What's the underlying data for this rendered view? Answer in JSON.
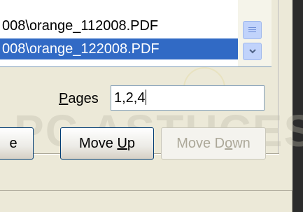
{
  "file_list": {
    "items": [
      {
        "label": "008\\orange_112008.PDF",
        "selected": false
      },
      {
        "label": "008\\orange_122008.PDF",
        "selected": true
      }
    ]
  },
  "pages": {
    "label_underlined": "P",
    "label_rest": "ages",
    "value": "1,2,4"
  },
  "buttons": {
    "partial_label": "e",
    "move_up": {
      "before": "Move ",
      "underlined": "U",
      "after": "p"
    },
    "move_down": {
      "before": "Move D",
      "underlined": "o",
      "after": "wn"
    }
  },
  "watermark": {
    "text": "PC ASTUCES"
  },
  "colors": {
    "selection": "#316ac5",
    "face": "#ece9d8",
    "disabled_text": "#aca899"
  }
}
